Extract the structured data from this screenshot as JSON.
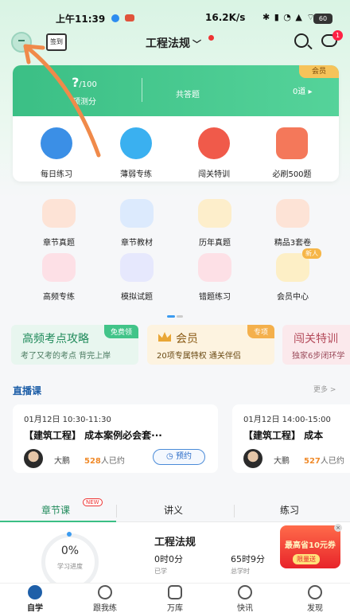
{
  "status_bar": {
    "time": "上午11:39",
    "network": "16.2K/s",
    "sys_icons": "✱ ▮ ◔ ▲ ⌔",
    "battery": "60"
  },
  "header": {
    "signin_label": "签到",
    "subject": "工程法规",
    "msg_badge": "1"
  },
  "stats": {
    "score_value": "?",
    "score_unit": "/100",
    "score_label": "预测分",
    "answered_label": "共答题",
    "vip_tag": "会员",
    "third_value": "0道 ▸"
  },
  "quick_actions": [
    "每日练习",
    "薄弱专练",
    "闯关特训",
    "必刷500题"
  ],
  "grid_items": [
    "章节真题",
    "章节教材",
    "历年真题",
    "精品3套卷",
    "高频专练",
    "模拟试题",
    "错题练习",
    "会员中心"
  ],
  "grid_new_badge": "新人",
  "promos": {
    "p1": {
      "title": "高频考点攻略",
      "subtitle": "考了又考的考点 背完上岸",
      "tag": "免费领"
    },
    "p2": {
      "title": "会员",
      "subtitle": "20项专属特权  通关伴侣",
      "tag": "专项"
    },
    "p3": {
      "title": "闯关特训",
      "subtitle": "独家6步闭环学"
    }
  },
  "live": {
    "title": "直播课",
    "more": "更多 >",
    "cards": [
      {
        "time": "01月12日  10:30-11:30",
        "title": "【建筑工程】 成本案例必会套···",
        "teacher": "大鹏",
        "count": "528",
        "count_suffix": "人已约",
        "button": "◷ 预约"
      },
      {
        "time": "01月12日  14:00-15:00",
        "title": "【建筑工程】 成本",
        "teacher": "大鹏",
        "count": "527",
        "count_suffix": "人已约"
      }
    ]
  },
  "tabs": {
    "t1": "章节课",
    "t2": "讲义",
    "t3": "练习",
    "new": "NEW"
  },
  "course_summary": {
    "progress_value": "0%",
    "progress_label": "学习进度",
    "title": "工程法规",
    "studied_value": "0时0分",
    "studied_label": "已学",
    "total_value": "65时9分",
    "total_label": "总学时"
  },
  "promo_float": {
    "text": "最高省10元券",
    "tag": "限量送"
  },
  "bottom_nav": [
    "自学",
    "跟我练",
    "万库",
    "快讯",
    "发现"
  ],
  "colors": {
    "accent": "#3bbf85",
    "link": "#1e5fa8",
    "annotation": "#f08a4a"
  }
}
